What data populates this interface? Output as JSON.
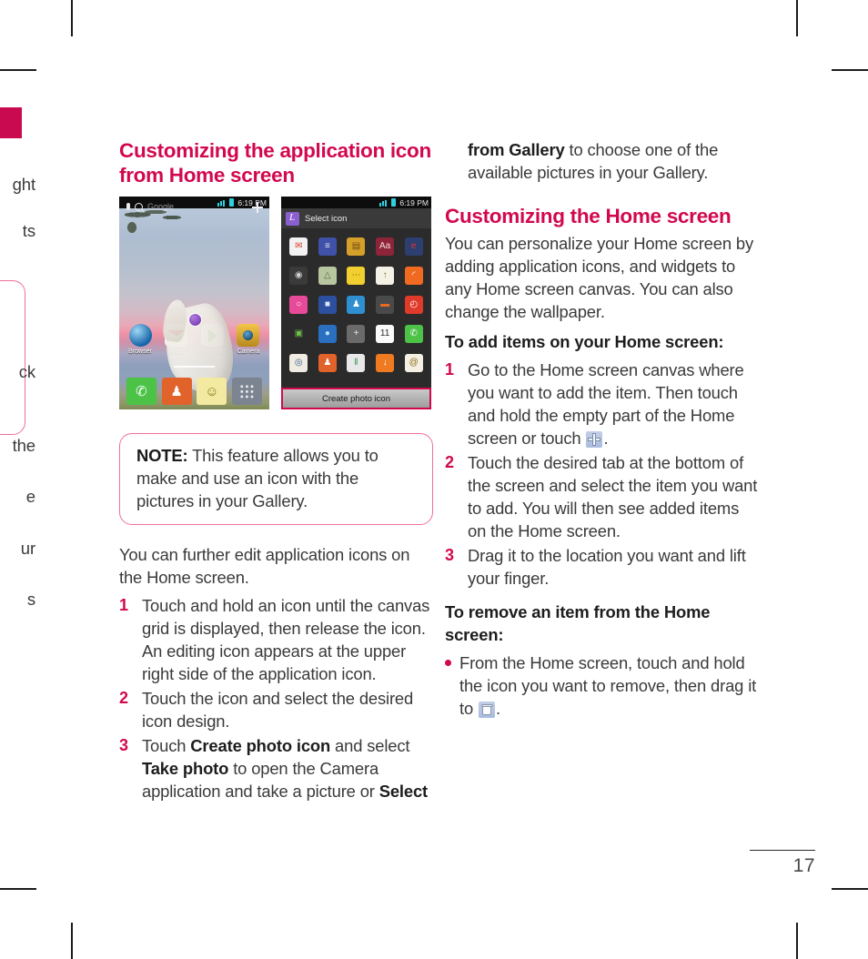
{
  "page": {
    "number": "17"
  },
  "bleed": {
    "fragments": [
      "ght",
      "ts",
      "ck",
      "the",
      "e",
      "ur",
      "s"
    ]
  },
  "left_column": {
    "heading": "Customizing the application icon from Home screen",
    "note": {
      "label": "NOTE:",
      "text": " This feature allows you to make and use an icon with the pictures in your Gallery."
    },
    "intro": "You can further edit application icons on the Home screen.",
    "steps": [
      {
        "num": "1",
        "text": "Touch and hold an icon until the canvas grid is displayed, then release the icon. An editing icon appears at the upper right side of the application icon."
      },
      {
        "num": "2",
        "text": "Touch the icon and select the desired icon design."
      },
      {
        "num": "3",
        "pre": "Touch ",
        "bold1": "Create photo icon",
        "mid1": " and select ",
        "bold2": "Take photo",
        "mid2": " to open the Camera application and take a picture or ",
        "bold3": "Select"
      }
    ]
  },
  "right_column": {
    "continuation": {
      "bold": "from Gallery",
      "text": " to choose one of the available pictures in your Gallery."
    },
    "heading": "Customizing the Home screen",
    "intro": "You can personalize your Home screen by adding application icons, and widgets to any Home screen canvas. You can also change the wallpaper.",
    "subhead_add": "To add items on your Home screen:",
    "add_steps": [
      {
        "num": "1",
        "pre": "Go to the Home screen canvas where you want to add the item. Then touch and hold the empty part of the Home screen or touch ",
        "icon": "plus-icon",
        "post": "."
      },
      {
        "num": "2",
        "text": "Touch the desired tab at the bottom of the screen and select the item you want to add. You will then see added items on the Home screen."
      },
      {
        "num": "3",
        "text": "Drag it to the location you want and lift your finger."
      }
    ],
    "subhead_remove": "To remove an item from the Home screen:",
    "remove_bullets": [
      {
        "pre": "From the Home screen, touch and hold the icon you want to remove, then drag it to ",
        "icon": "trash-icon",
        "post": "."
      }
    ]
  },
  "screenshots": {
    "home": {
      "status_time": "6:19 PM",
      "search_placeholder": "Google",
      "apps": [
        {
          "label": "Browser",
          "icon": "browser-icon"
        },
        {
          "label": "Gmail",
          "icon": "gmail-icon"
        },
        {
          "label": "Play Store",
          "icon": "play-store-icon"
        },
        {
          "label": "Camera",
          "icon": "camera-icon"
        }
      ],
      "dock": [
        {
          "label": "Phone",
          "icon": "phone-icon",
          "glyph": "✆"
        },
        {
          "label": "Contacts",
          "icon": "contacts-icon",
          "glyph": "♟"
        },
        {
          "label": "Messaging",
          "icon": "messaging-icon",
          "glyph": "☺"
        },
        {
          "label": "Apps",
          "icon": "apps-grid-icon",
          "glyph": ""
        }
      ]
    },
    "picker": {
      "status_time": "6:19 PM",
      "title": "Select icon",
      "button_label": "Create photo icon",
      "icons": [
        {
          "name": "email-check-icon",
          "glyph": "✉",
          "color": "#f2f2f2",
          "fg": "#d93b2b"
        },
        {
          "name": "fitness-icon",
          "glyph": "≡",
          "color": "#3f51a8",
          "fg": "#dfe4f5"
        },
        {
          "name": "wallet-icon",
          "glyph": "▤",
          "color": "#d5a02a",
          "fg": "#6b4a0e"
        },
        {
          "name": "dictionary-icon",
          "glyph": "Aa",
          "color": "#8e2438",
          "fg": "#f1dede"
        },
        {
          "name": "ebook-icon",
          "glyph": "e",
          "color": "#2c3f70",
          "fg": "#e8322a"
        },
        {
          "name": "gamepad-icon",
          "glyph": "◉",
          "color": "#3a3a3a",
          "fg": "#cfcfcf"
        },
        {
          "name": "maps-icon",
          "glyph": "△",
          "color": "#b8c6a0",
          "fg": "#4b6b3a"
        },
        {
          "name": "chat-bubble-icon",
          "glyph": "⋯",
          "color": "#f0cf2e",
          "fg": "#6a5a10"
        },
        {
          "name": "restaurant-icon",
          "glyph": "↑",
          "color": "#f4f1e6",
          "fg": "#8a7a3a"
        },
        {
          "name": "rss-icon",
          "glyph": "◜",
          "color": "#f06a22",
          "fg": "#ffffff"
        },
        {
          "name": "search-photo-icon",
          "glyph": "○",
          "color": "#e84a9a",
          "fg": "#ffffff"
        },
        {
          "name": "shopping-cart-icon",
          "glyph": "■",
          "color": "#2d4fa0",
          "fg": "#dce6ff"
        },
        {
          "name": "social-group-icon",
          "glyph": "♟",
          "color": "#2f8fd0",
          "fg": "#ffffff"
        },
        {
          "name": "transit-icon",
          "glyph": "▬",
          "color": "#4a4a4a",
          "fg": "#e86a22"
        },
        {
          "name": "alarm-clock-icon",
          "glyph": "◴",
          "color": "#e03a2a",
          "fg": "#ffffff"
        },
        {
          "name": "gallery-icon",
          "glyph": "▣",
          "color": "#2b2b2b",
          "fg": "#6fbf4a"
        },
        {
          "name": "globe-icon",
          "glyph": "●",
          "color": "#2a6fc0",
          "fg": "#bfe0ff"
        },
        {
          "name": "calculator-icon",
          "glyph": "+",
          "color": "#6a6a6a",
          "fg": "#e8e8e8"
        },
        {
          "name": "calendar-icon",
          "glyph": "11",
          "color": "#fafafa",
          "fg": "#2a2a2a"
        },
        {
          "name": "call-log-icon",
          "glyph": "✆",
          "color": "#4cc247",
          "fg": "#ffffff"
        },
        {
          "name": "camera-icon",
          "glyph": "◎",
          "color": "#f0ece2",
          "fg": "#3a5a8a"
        },
        {
          "name": "contacts-icon",
          "glyph": "♟",
          "color": "#e2622c",
          "fg": "#ffffff"
        },
        {
          "name": "color-bars-icon",
          "glyph": "‖",
          "color": "#e8e8e8",
          "fg": "#2a8f4a"
        },
        {
          "name": "download-icon",
          "glyph": "↓",
          "color": "#f07a22",
          "fg": "#ffffff"
        },
        {
          "name": "at-mail-icon",
          "glyph": "@",
          "color": "#f4f0e4",
          "fg": "#8a6a10"
        }
      ]
    }
  },
  "colors": {
    "accent": "#d2084f",
    "note_border": "#ef6f9e",
    "body_text": "#3a3a3a"
  }
}
